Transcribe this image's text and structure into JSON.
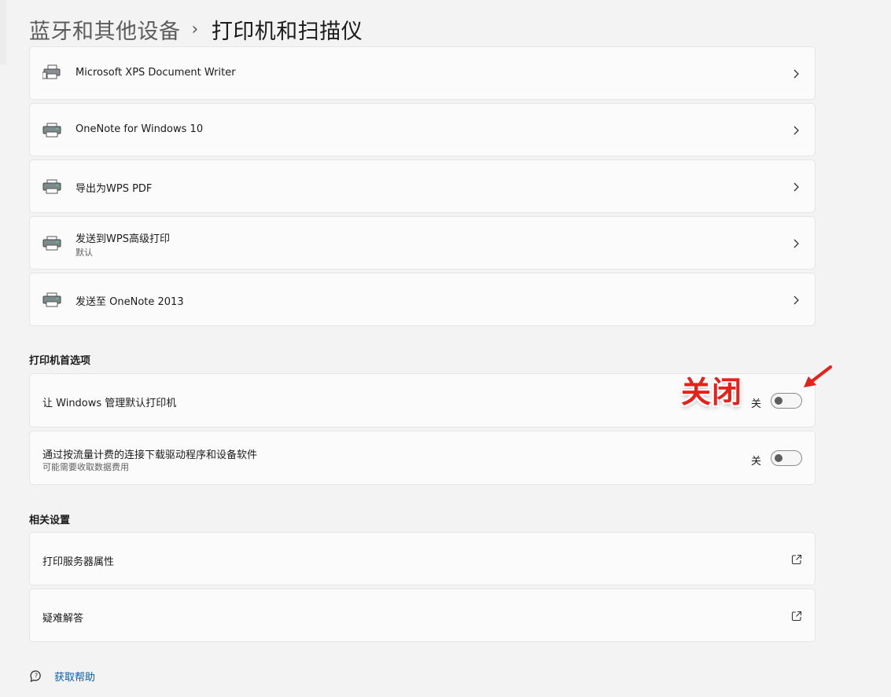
{
  "header": {
    "parent": "蓝牙和其他设备",
    "separator": "›",
    "current": "打印机和扫描仪"
  },
  "printers": [
    {
      "name": "Microsoft XPS Document Writer",
      "subtitle": "",
      "icon": "printer-icon"
    },
    {
      "name": "OneNote for Windows 10",
      "subtitle": "",
      "icon": "printer-icon"
    },
    {
      "name": "导出为WPS PDF",
      "subtitle": "",
      "icon": "printer-icon"
    },
    {
      "name": "发送到WPS高级打印",
      "subtitle": "默认",
      "icon": "printer-icon"
    },
    {
      "name": "发送至 OneNote 2013",
      "subtitle": "",
      "icon": "printer-icon"
    }
  ],
  "preferences": {
    "title": "打印机首选项",
    "items": [
      {
        "label": "让 Windows 管理默认打印机",
        "subtitle": "",
        "state": "关",
        "on": false
      },
      {
        "label": "通过按流量计费的连接下载驱动程序和设备软件",
        "subtitle": "可能需要收取数据费用",
        "state": "关",
        "on": false
      }
    ]
  },
  "related": {
    "title": "相关设置",
    "items": [
      {
        "label": "打印服务器属性",
        "icon": "external-link-icon"
      },
      {
        "label": "疑难解答",
        "icon": "external-link-icon"
      }
    ]
  },
  "help": {
    "label": "获取帮助",
    "icon": "help-icon"
  },
  "annotation": {
    "text": "关闭",
    "color": "#e8201a"
  }
}
